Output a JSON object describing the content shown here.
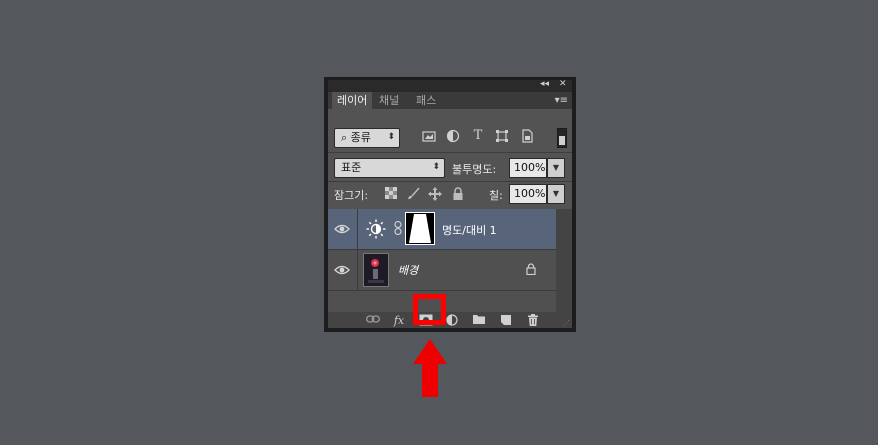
{
  "panel": {
    "titlebar_controls": {
      "collapse": "◂◂",
      "close": "✕"
    },
    "menu_icon": "▾≡",
    "tabs": [
      {
        "label": "레이어",
        "active": true
      },
      {
        "label": "채널",
        "active": false
      },
      {
        "label": "패스",
        "active": false
      }
    ],
    "filter": {
      "search_glyph": "⌕",
      "kind_label": "종류",
      "icons": [
        "image-filter-icon",
        "adjustment-filter-icon",
        "type-filter-icon",
        "shape-filter-icon",
        "smart-object-filter-icon"
      ],
      "type_glyph": "T"
    },
    "blend": {
      "mode": "표준",
      "opacity_label": "불투명도:",
      "opacity_value": "100%"
    },
    "lock": {
      "label": "잠그기:",
      "fill_label": "칠:",
      "fill_value": "100%"
    },
    "layers": [
      {
        "name": "명도/대비 1",
        "selected": true,
        "type": "adjustment",
        "visible": true
      },
      {
        "name": "배경",
        "selected": false,
        "type": "background",
        "locked": true,
        "visible": true
      }
    ],
    "bottom_icons": [
      "link-icon",
      "fx-icon",
      "add-mask-icon",
      "new-adjustment-icon",
      "group-folder-icon",
      "new-layer-icon",
      "delete-icon"
    ],
    "fx_label": "fx"
  },
  "annotation": {
    "highlight_color": "#ff0000",
    "highlighted_control": "add-mask-icon"
  },
  "colors": {
    "background": "#54575c",
    "panel": "#535353",
    "selected_layer": "#58647a"
  }
}
